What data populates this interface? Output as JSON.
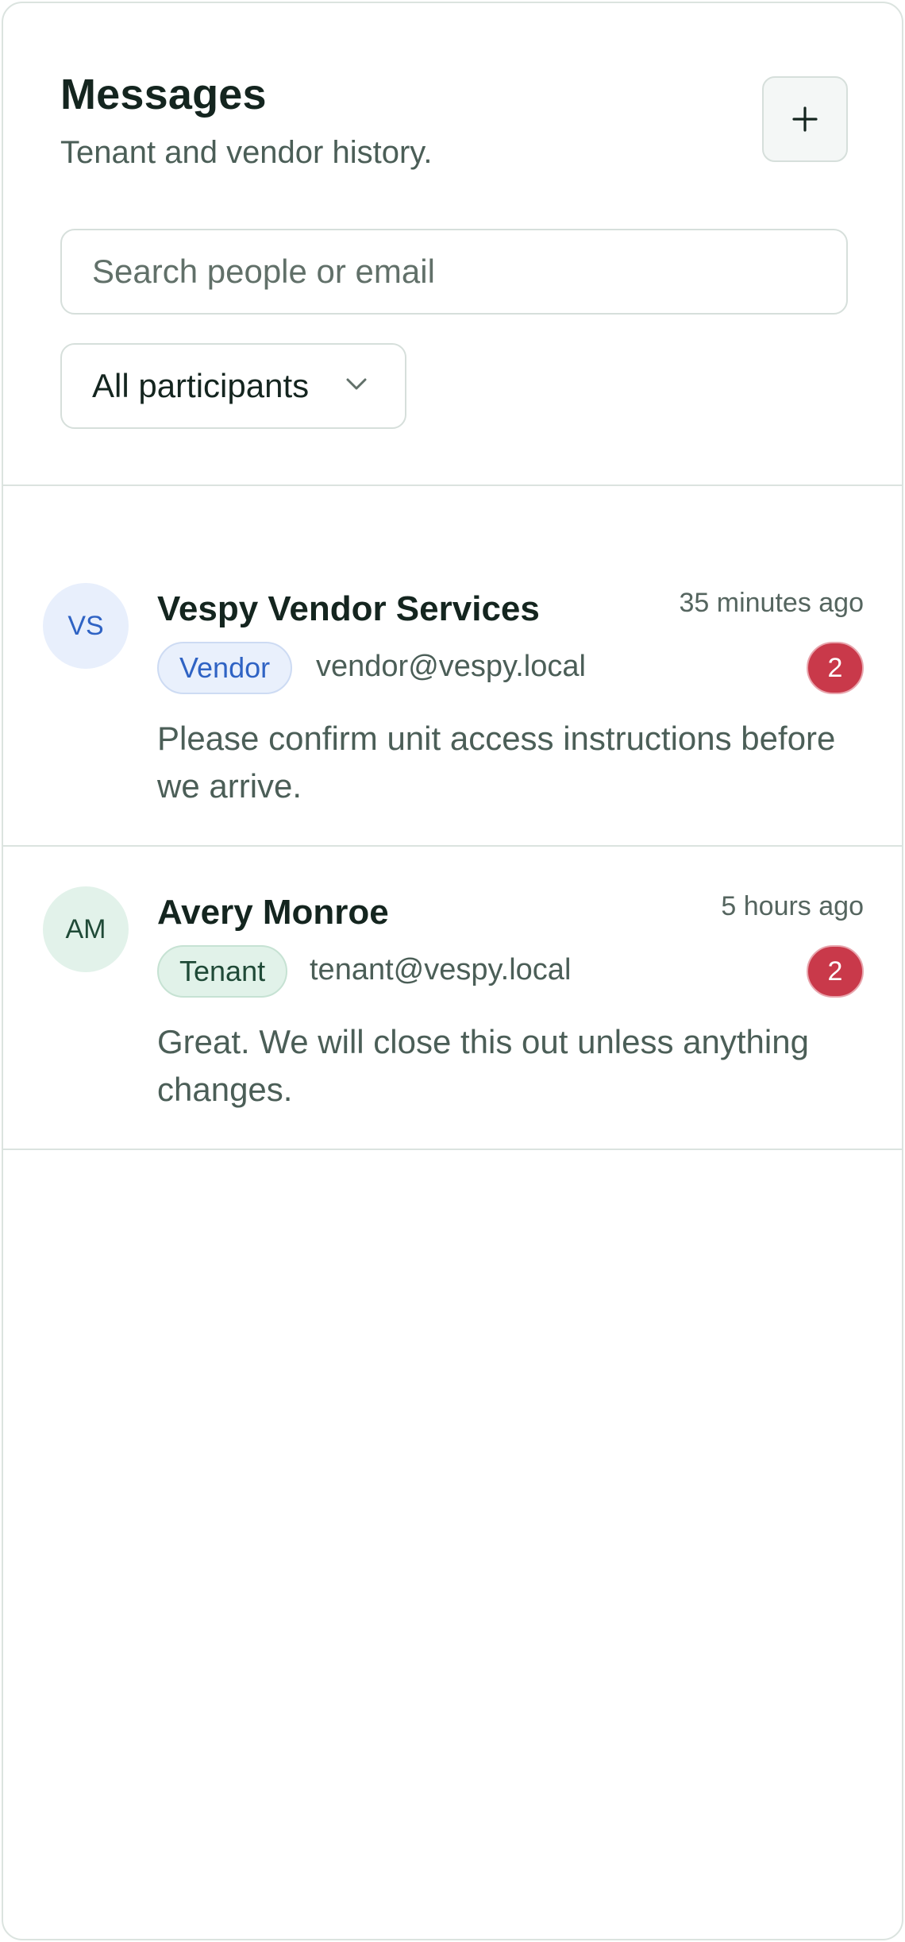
{
  "header": {
    "title": "Messages",
    "subtitle": "Tenant and vendor history.",
    "new_button_icon": "plus-icon"
  },
  "search": {
    "placeholder": "Search people or email",
    "value": ""
  },
  "filter": {
    "selected": "All participants",
    "icon": "chevron-down-icon"
  },
  "conversations": [
    {
      "initials": "VS",
      "name": "Vespy Vendor Services",
      "time": "35 minutes ago",
      "role": "Vendor",
      "email": "vendor@vespy.local",
      "unread": "2",
      "preview": "Please confirm unit access instructions before we arrive."
    },
    {
      "initials": "AM",
      "name": "Avery Monroe",
      "time": "5 hours ago",
      "role": "Tenant",
      "email": "tenant@vespy.local",
      "unread": "2",
      "preview": "Great. We will close this out unless anything changes."
    }
  ],
  "colors": {
    "vendor_accent": "#2f63c4",
    "tenant_accent": "#1f4a37",
    "unread_badge": "#c9394a",
    "border": "#dbe3df"
  }
}
